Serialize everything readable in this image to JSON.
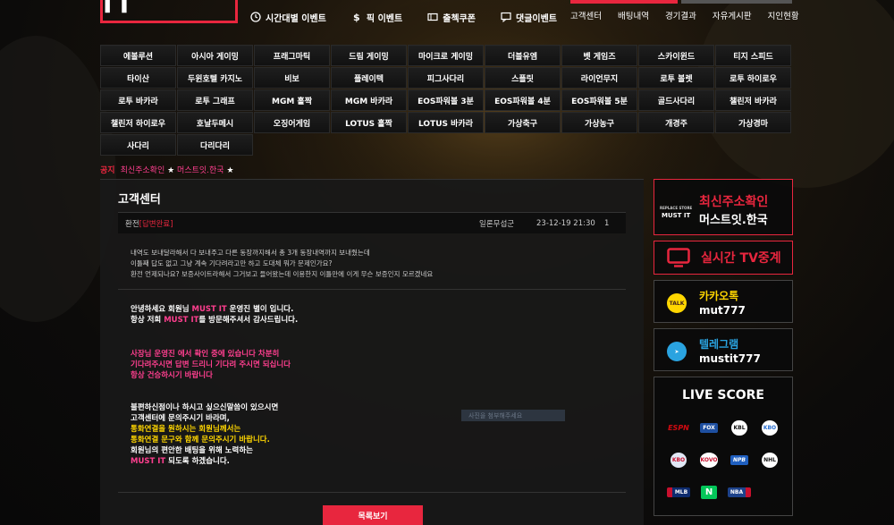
{
  "header": {
    "logo": "MUST IT",
    "events": [
      {
        "icon": "clock-icon",
        "label": "시간대별 이벤트"
      },
      {
        "icon": "dollar-icon",
        "label": "픽 이벤트"
      },
      {
        "icon": "coupon-icon",
        "label": "출첵쿠폰"
      },
      {
        "icon": "comment-icon",
        "label": "댓글이벤트"
      }
    ],
    "nav": [
      "고객센터",
      "배팅내역",
      "경기결과",
      "자유게시판",
      "지인현황"
    ]
  },
  "games": [
    "에볼루션",
    "아시아 게이밍",
    "프래그마틱",
    "드림 게이밍",
    "마이크로 게이밍",
    "더블유엠",
    "벳 게임즈",
    "스카이윈드",
    "티지 스피드",
    "타이산",
    "두윈호텔 카지노",
    "비보",
    "플레이텍",
    "피그사다리",
    "스플릿",
    "라이언무지",
    "로투 볼렛",
    "로투 하이로우",
    "로투 바카라",
    "로투 그래프",
    "MGM 홀짝",
    "MGM 바카라",
    "EOS파워볼 3분",
    "EOS파워볼 4분",
    "EOS파워볼 5분",
    "골드사다리",
    "챌린저 바카라",
    "챌린저 하이로우",
    "호날두메시",
    "오징어게임",
    "LOTUS 홀짝",
    "LOTUS 바카라",
    "가상축구",
    "가상농구",
    "개경주",
    "가상경마",
    "사다리",
    "다리다리"
  ],
  "notice": {
    "label": "공지",
    "text": "최신주소확인 ",
    "star1": "★",
    "domain": " 머스트잇.한국 ",
    "star2": "★"
  },
  "panel": {
    "title": "고객센터",
    "post": {
      "type": "환전",
      "status": "[답변완료]",
      "author": "일론무섭군",
      "date": "23-12-19 21:30",
      "num": "1"
    },
    "question": [
      "내역도 보내달라해서 다 보내주고 다른 동장까지해서 총 3개 동장내역까지 보내줬는데",
      "이틀째 답도 없고 그냥 계속 기다려라고만 하고 도대체 뭐가 문제인가요?",
      "환전 언제되나요? 보증사이트라해서 그거보고 들어왔는데 이용한지 이틀만에 이게 무슨 보증인지 모르겠네요"
    ],
    "answer": {
      "a1_pre": "안녕하세요 회원님 ",
      "brand": "MUST IT",
      "a1_post": " 운영진 별이 입니다.",
      "a1b_pre": "항상 저희 ",
      "a1b_post": "를 방문해주셔서 감사드립니다.",
      "a2": [
        "사장님 운영진 에서 확인 중에 있습니다 차분히",
        "기다려주시면 답변 드리니 기다려 주시면 되십니다",
        "항상 건승하시기 바랍니다"
      ],
      "a3_1": "불편하신점이나 하시고 싶으신말씀이 있으시면",
      "a3_2": "고객센터에 문의주시기 바라며,",
      "a3_3": "통화연결을 원하시는 회원님께서는",
      "a3_4": "통화연결 문구와 함께 문의주시기 바랍니다.",
      "a3_5": "회원님의 편안한 배팅을 위해 노력하는",
      "a3_6": " 되도록 하겠습니다.",
      "faded": "사진을 첨부해주세요"
    },
    "list_button": "목록보기"
  },
  "sidebar": {
    "domain": {
      "mini": "MUST IT",
      "mini_top": "REPLACE STORE",
      "line1": "최신주소확인",
      "line2": "머스트잇.한국"
    },
    "tv": "실시간 TV중계",
    "kakao": {
      "icon_text": "TALK",
      "name": "카카오톡",
      "id": "mut777"
    },
    "telegram": {
      "icon_text": "➤",
      "name": "텔레그램",
      "id": "mustit777"
    },
    "live_title": "LIVE SCORE",
    "leagues": [
      {
        "icon": "espn-icon",
        "label": "ESPN",
        "color": "#d20a11"
      },
      {
        "icon": "ufc-icon",
        "label": "FOX",
        "color": "#1e4fa0"
      },
      {
        "icon": "kbl-icon",
        "label": "KBL",
        "color": "#ffffff"
      },
      {
        "icon": "kbo-baseball-icon",
        "label": "KBO",
        "color": "#2a6fd1"
      },
      {
        "icon": "kbo-league-icon",
        "label": "KBO",
        "color": "#ffffff"
      },
      {
        "icon": "kovo-icon",
        "label": "KOVO",
        "color": "#ffffff"
      },
      {
        "icon": "npb-icon",
        "label": "NPB",
        "color": "#1f5fbf"
      },
      {
        "icon": "nhl-icon",
        "label": "NHL",
        "color": "#ffffff"
      },
      {
        "icon": "mlb-icon",
        "label": "MLB",
        "color": "#0d2b6e"
      },
      {
        "icon": "naver-icon",
        "label": "N",
        "color": "#03c75a"
      },
      {
        "icon": "nba-icon",
        "label": "NBA",
        "color": "#1d428a"
      }
    ]
  }
}
